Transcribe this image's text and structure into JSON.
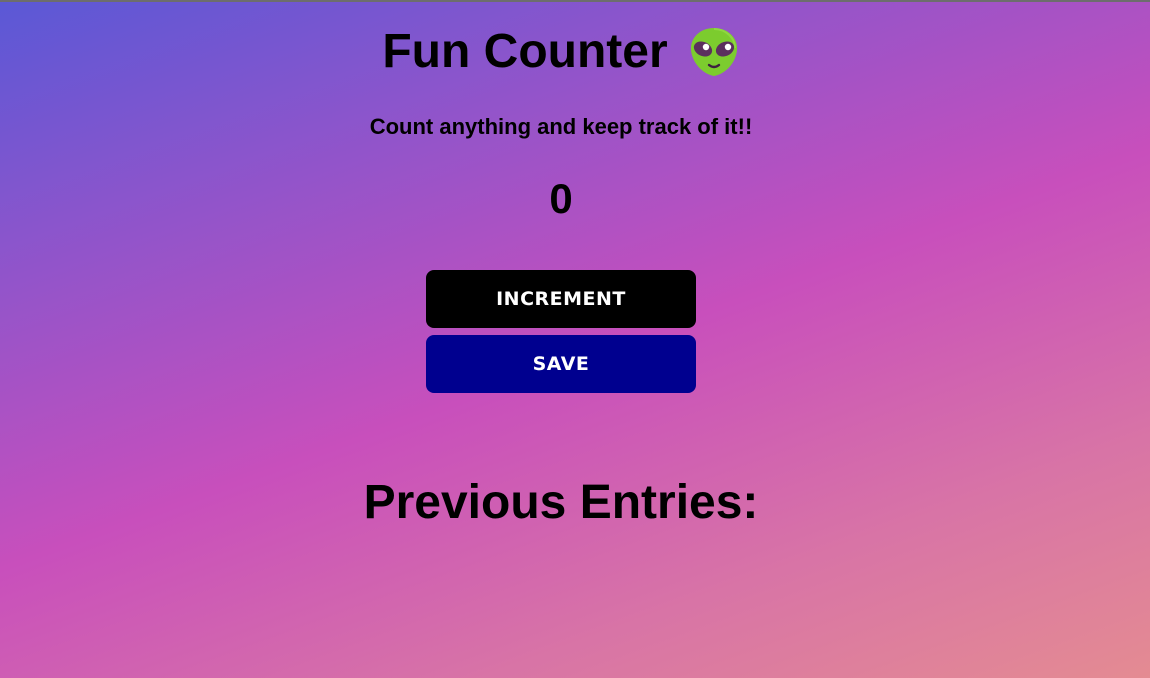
{
  "app": {
    "title": "Fun Counter",
    "title_icon": "alien-icon",
    "subtitle": "Count anything and keep track of it!!"
  },
  "counter": {
    "value": "0"
  },
  "buttons": {
    "increment_label": "INCREMENT",
    "save_label": "SAVE"
  },
  "entries": {
    "heading": "Previous Entries:",
    "items": []
  },
  "colors": {
    "increment_button": "#000000",
    "save_button": "#00008f",
    "gradient_start": "#5a58d6",
    "gradient_mid": "#c84fbc",
    "gradient_end": "#e48b92"
  }
}
